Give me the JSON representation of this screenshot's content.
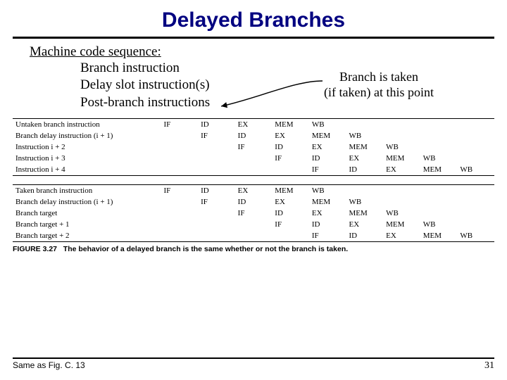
{
  "title": "Delayed Branches",
  "mcs_heading": "Machine code sequence:",
  "sequence": {
    "line1": "Branch instruction",
    "line2": "Delay slot instruction(s)",
    "line3": "Post-branch instructions"
  },
  "branch_note": {
    "line1": "Branch is taken",
    "line2": "(if taken) at this point"
  },
  "stages": [
    "IF",
    "ID",
    "EX",
    "MEM",
    "WB"
  ],
  "table1": {
    "rows": [
      {
        "label": "Untaken branch instruction",
        "offset": 0
      },
      {
        "label": "Branch delay instruction (i + 1)",
        "offset": 1
      },
      {
        "label": "Instruction i + 2",
        "offset": 2
      },
      {
        "label": "Instruction i + 3",
        "offset": 3
      },
      {
        "label": "Instruction i + 4",
        "offset": 4
      }
    ]
  },
  "table2": {
    "rows": [
      {
        "label": "Taken branch instruction",
        "offset": 0
      },
      {
        "label": "Branch delay instruction (i + 1)",
        "offset": 1
      },
      {
        "label": "Branch target",
        "offset": 2
      },
      {
        "label": "Branch target + 1",
        "offset": 3
      },
      {
        "label": "Branch target + 2",
        "offset": 4
      }
    ]
  },
  "figure_caption_prefix": "FIGURE 3.27",
  "figure_caption_text": "The behavior of a delayed branch is the same whether or not the branch is taken.",
  "footer_note": "Same as Fig. C. 13",
  "page_number": "31"
}
